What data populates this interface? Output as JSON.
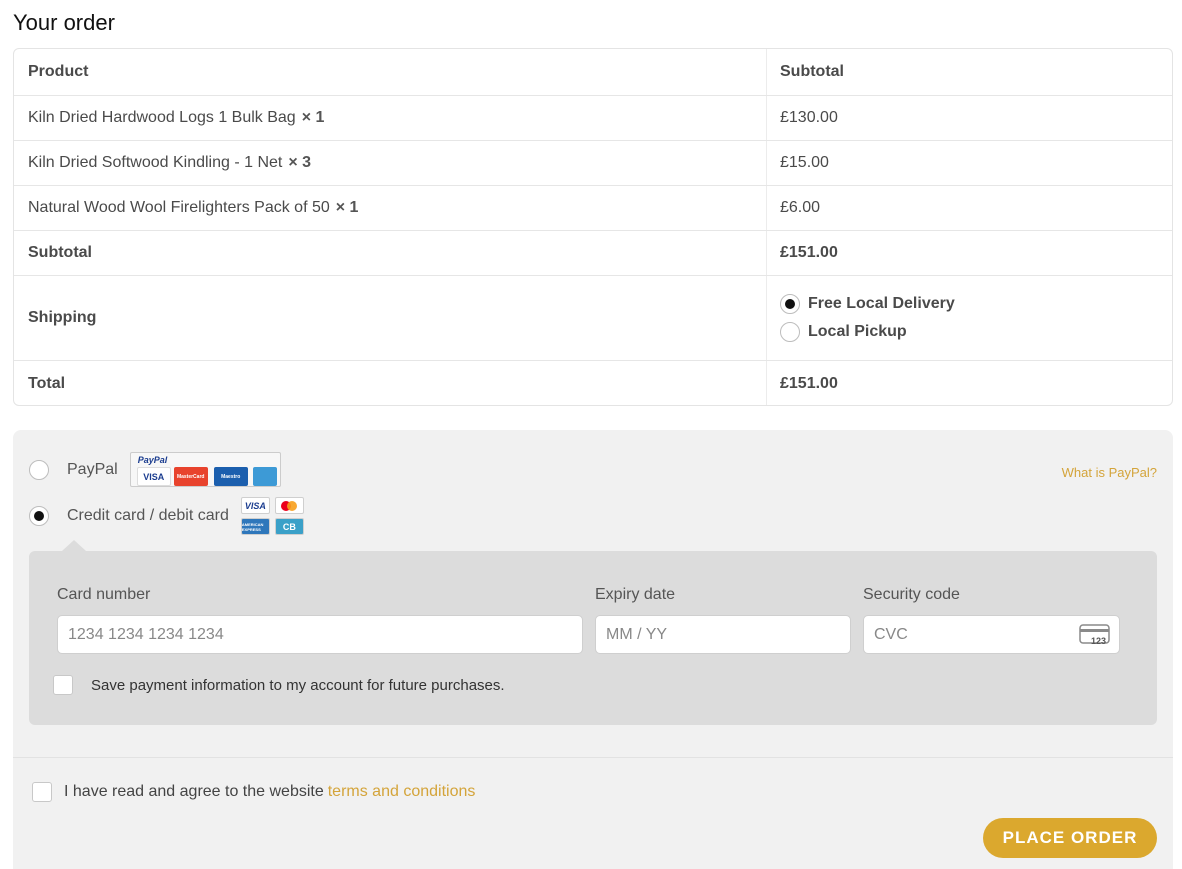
{
  "heading": "Your order",
  "table": {
    "col_product": "Product",
    "col_subtotal": "Subtotal",
    "items": [
      {
        "name": "Kiln Dried Hardwood Logs 1 Bulk Bag",
        "qty": "× 1",
        "price": "£130.00"
      },
      {
        "name": "Kiln Dried Softwood Kindling - 1 Net",
        "qty": "× 3",
        "price": "£15.00"
      },
      {
        "name": "Natural Wood Wool Firelighters Pack of 50",
        "qty": "× 1",
        "price": "£6.00"
      }
    ],
    "subtotal_label": "Subtotal",
    "subtotal_value": "£151.00",
    "shipping_label": "Shipping",
    "shipping_options": [
      {
        "label": "Free Local Delivery",
        "selected": true
      },
      {
        "label": "Local Pickup",
        "selected": false
      }
    ],
    "total_label": "Total",
    "total_value": "£151.00"
  },
  "payment": {
    "paypal_label": "PayPal",
    "paypal_badge_logo": "PayPal",
    "paypal_badge_cards": [
      "VISA",
      "MasterCard",
      "Maestro",
      "AMEX"
    ],
    "what_is_paypal": "What is PayPal?",
    "card_label": "Credit card / debit card",
    "card_logos": [
      "VISA",
      "mastercard-icon",
      "AMERICAN EXPRESS",
      "CB"
    ],
    "card_number_label": "Card number",
    "card_number_placeholder": "1234 1234 1234 1234",
    "expiry_label": "Expiry date",
    "expiry_placeholder": "MM / YY",
    "cvc_label": "Security code",
    "cvc_placeholder": "CVC",
    "cvc_icon_text": "123",
    "save_info": "Save payment information to my account for future purchases.",
    "terms_text": "I have read and agree to the website",
    "terms_link": "terms and conditions",
    "place_order": "PLACE ORDER"
  },
  "colors": {
    "accent": "#dba82e",
    "link": "#d4a43a"
  }
}
